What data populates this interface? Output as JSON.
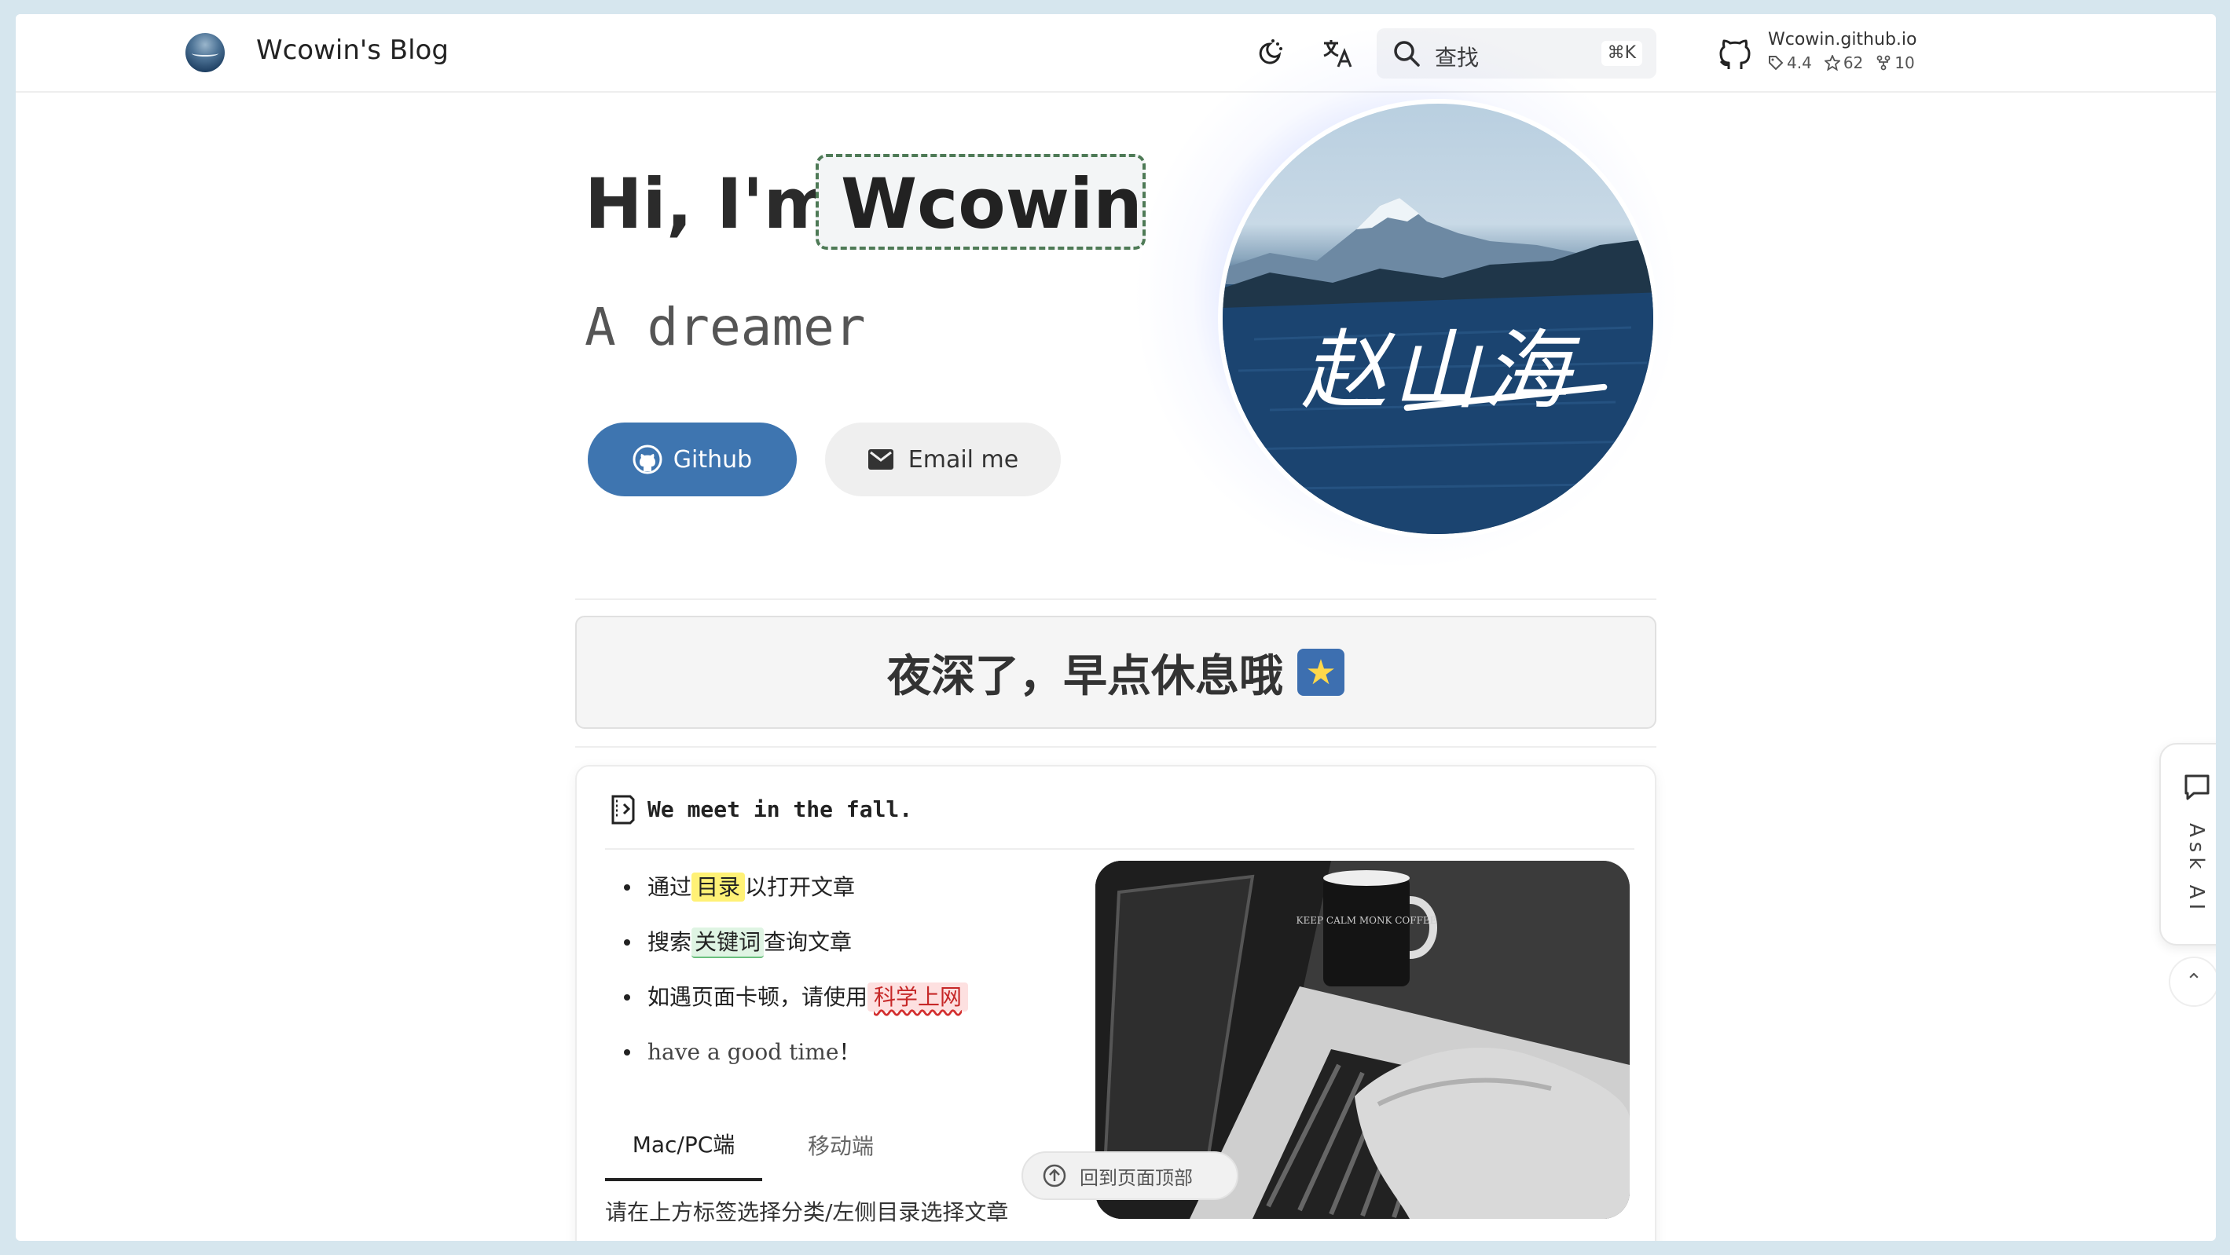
{
  "header": {
    "site_title": "Wcowin's Blog",
    "search_placeholder": "查找",
    "search_shortcut": "⌘K",
    "repo": {
      "name": "Wcowin.github.io",
      "version": "4.4",
      "stars": "62",
      "forks": "10"
    }
  },
  "hero": {
    "greeting": "Hi, I'm",
    "name": "Wcowin",
    "tagline": "A dreamer",
    "github_label": "Github",
    "email_label": "Email me",
    "avatar_signature": "赵山海"
  },
  "notice": {
    "text": "夜深了，早点休息哦"
  },
  "card": {
    "title": "We meet in the fall.",
    "tips": [
      {
        "before": "通过",
        "highlight": "目录",
        "after": "以打开文章"
      },
      {
        "before": "搜索",
        "highlight": "关键词",
        "after": "查询文章"
      },
      {
        "before": "如遇页面卡顿，请使用",
        "highlight": "科学上网",
        "after": ""
      },
      {
        "before": "have a good time",
        "highlight": "",
        "after": "！"
      }
    ],
    "tabs": [
      "Mac/PC端",
      "移动端"
    ],
    "tab_content": "请在上方标签选择分类/左侧目录选择文章",
    "laptop_mug_text": "KEEP CALM MONK COFFEE"
  },
  "back_to_top": "回到页面顶部",
  "ask_ai": "Ask AI",
  "colors": {
    "accent": "#3e75b0",
    "highlight_yellow": "#fff176",
    "highlight_green": "#dff4e3",
    "highlight_pink": "#fde0e0"
  }
}
